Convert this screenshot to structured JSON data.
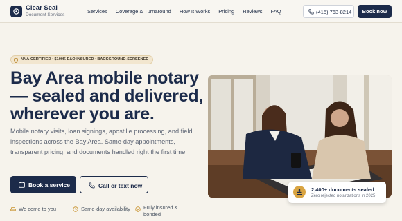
{
  "header": {
    "brand": "Clear Seal",
    "brand_sub": "Document Services",
    "menu": [
      "Services",
      "Coverage & Turnaround",
      "How It Works",
      "Pricing",
      "Reviews",
      "FAQ"
    ],
    "phone": "(415) 763-8214",
    "book_label": "Book now"
  },
  "hero": {
    "badge": "NNA-CERTIFIED · $100K E&O INSURED · BACKGROUND-SCREENED",
    "headline": "Bay Area mobile notary — sealed and delivered, wherever you are.",
    "lead": "Mobile notary visits, loan signings, apostille processing, and field inspections across the Bay Area. Same-day appointments, transparent pricing, and documents handled right the first time.",
    "cta_primary": "Book a service",
    "cta_secondary": "Call or text now",
    "features": [
      "We come to you",
      "Same-day availability",
      "Fully insured & bonded"
    ]
  },
  "stat_card": {
    "title": "2,400+ documents sealed",
    "subtitle": "Zero rejected notarizations in 2025"
  },
  "colors": {
    "navy": "#1c2b4a",
    "cream": "#f6f3ec",
    "gold": "#d9a441"
  },
  "icons": [
    "seal-logo-icon",
    "phone-icon",
    "shield-icon",
    "calendar-icon",
    "car-icon",
    "clock-icon",
    "check-shield-icon",
    "stamp-icon"
  ]
}
